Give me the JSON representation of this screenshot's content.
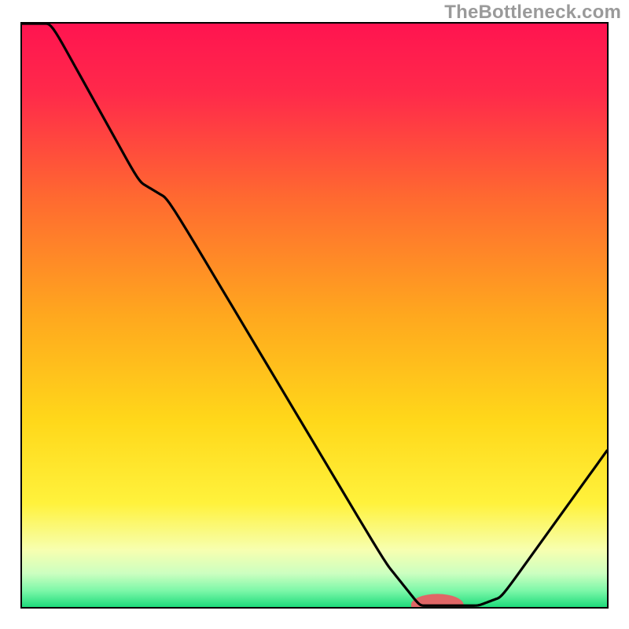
{
  "watermark": "TheBottleneck.com",
  "chart_data": {
    "type": "line",
    "title": "",
    "xlabel": "",
    "ylabel": "",
    "xlim": [
      0,
      100
    ],
    "ylim": [
      0,
      100
    ],
    "x": [
      0,
      5,
      20,
      25,
      62,
      68,
      72,
      78,
      82,
      100
    ],
    "y": [
      100,
      100,
      73,
      70,
      8,
      0.5,
      0.5,
      0.5,
      2,
      27
    ],
    "pill": {
      "cx": 71,
      "cy": 0.6,
      "rx": 4.5,
      "ry": 1.9,
      "color": "#e06666"
    },
    "gradient_stops": [
      {
        "offset": 0,
        "color": "#ff1450"
      },
      {
        "offset": 12,
        "color": "#ff2a4a"
      },
      {
        "offset": 30,
        "color": "#ff6a30"
      },
      {
        "offset": 50,
        "color": "#ffa81e"
      },
      {
        "offset": 68,
        "color": "#ffd81a"
      },
      {
        "offset": 82,
        "color": "#fff23c"
      },
      {
        "offset": 90,
        "color": "#f7ffb0"
      },
      {
        "offset": 94,
        "color": "#ccffc0"
      },
      {
        "offset": 97,
        "color": "#7bf7a8"
      },
      {
        "offset": 100,
        "color": "#15d877"
      }
    ],
    "curve_color": "#000000",
    "curve_width": 3.2
  }
}
